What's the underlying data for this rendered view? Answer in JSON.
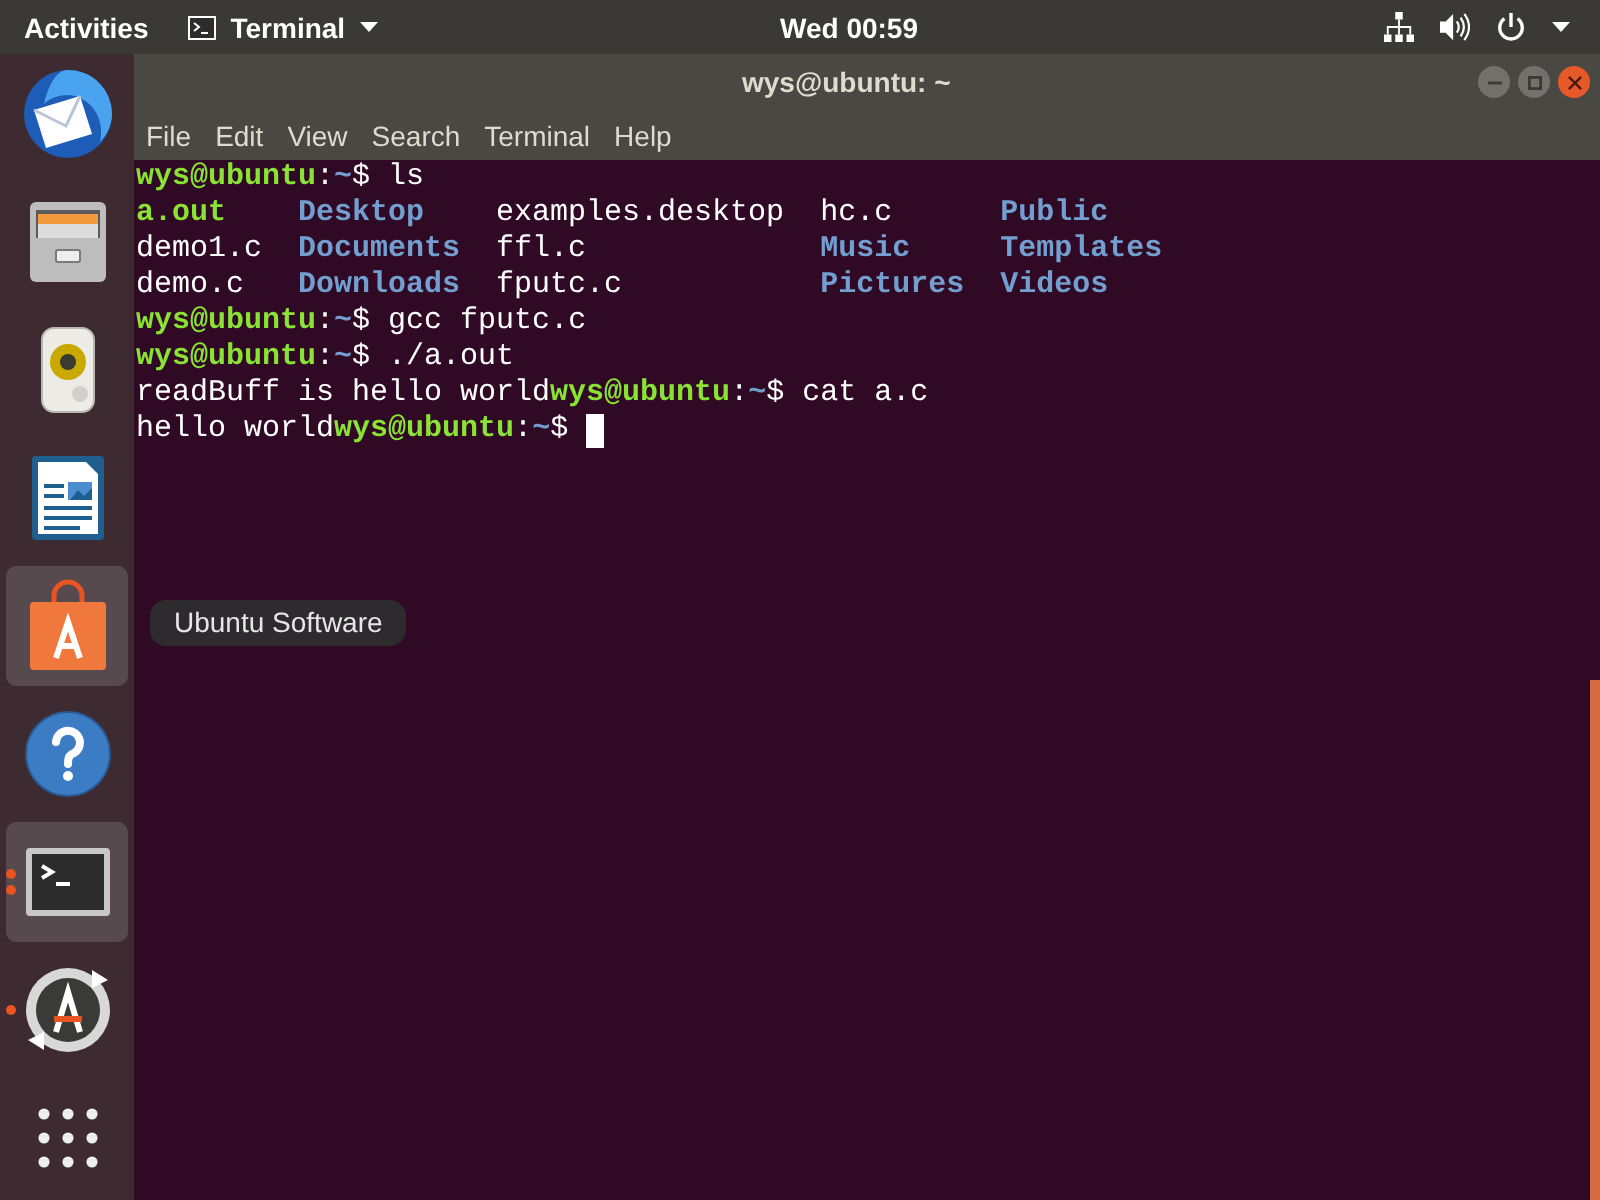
{
  "top_bar": {
    "activities": "Activities",
    "app_menu": "Terminal",
    "clock": "Wed 00:59"
  },
  "dock": {
    "items": [
      {
        "kind": "mail",
        "highlighted": false,
        "running": false,
        "multiple_windows": false
      },
      {
        "kind": "files",
        "highlighted": false,
        "running": false,
        "multiple_windows": false
      },
      {
        "kind": "music",
        "highlighted": false,
        "running": false,
        "multiple_windows": false
      },
      {
        "kind": "writer",
        "highlighted": false,
        "running": false,
        "multiple_windows": false
      },
      {
        "kind": "software",
        "highlighted": true,
        "running": false,
        "multiple_windows": false
      },
      {
        "kind": "help",
        "highlighted": false,
        "running": false,
        "multiple_windows": false
      },
      {
        "kind": "terminal",
        "highlighted": true,
        "running": true,
        "multiple_windows": true
      },
      {
        "kind": "updater",
        "highlighted": false,
        "running": true,
        "multiple_windows": false
      },
      {
        "kind": "apps",
        "highlighted": false,
        "running": false,
        "multiple_windows": false
      }
    ],
    "tooltip": "Ubuntu Software"
  },
  "window": {
    "title": "wys@ubuntu: ~",
    "menu": [
      "File",
      "Edit",
      "View",
      "Search",
      "Terminal",
      "Help"
    ],
    "terminal": {
      "cursor": true,
      "lines": [
        {
          "kind": "text",
          "segments": [
            {
              "kind": "user",
              "text": "wys@ubuntu"
            },
            {
              "kind": "plain",
              "text": ":"
            },
            {
              "kind": "path",
              "text": "~"
            },
            {
              "kind": "plain",
              "text": "$ ls"
            }
          ]
        },
        {
          "kind": "listing",
          "rows": [
            [
              {
                "kind": "exec",
                "text": "a.out"
              },
              {
                "kind": "dir",
                "text": "Desktop"
              },
              {
                "kind": "plain",
                "text": "examples.desktop"
              },
              {
                "kind": "plain",
                "text": "hc.c"
              },
              {
                "kind": "dir",
                "text": "Public"
              }
            ],
            [
              {
                "kind": "plain",
                "text": "demo1.c"
              },
              {
                "kind": "dir",
                "text": "Documents"
              },
              {
                "kind": "plain",
                "text": "ffl.c"
              },
              {
                "kind": "dir",
                "text": "Music"
              },
              {
                "kind": "dir",
                "text": "Templates"
              }
            ],
            [
              {
                "kind": "plain",
                "text": "demo.c"
              },
              {
                "kind": "dir",
                "text": "Downloads"
              },
              {
                "kind": "plain",
                "text": "fputc.c"
              },
              {
                "kind": "dir",
                "text": "Pictures"
              },
              {
                "kind": "dir",
                "text": "Videos"
              }
            ]
          ]
        },
        {
          "kind": "text",
          "segments": [
            {
              "kind": "user",
              "text": "wys@ubuntu"
            },
            {
              "kind": "plain",
              "text": ":"
            },
            {
              "kind": "path",
              "text": "~"
            },
            {
              "kind": "plain",
              "text": "$ gcc fputc.c"
            }
          ]
        },
        {
          "kind": "text",
          "segments": [
            {
              "kind": "user",
              "text": "wys@ubuntu"
            },
            {
              "kind": "plain",
              "text": ":"
            },
            {
              "kind": "path",
              "text": "~"
            },
            {
              "kind": "plain",
              "text": "$ ./a.out"
            }
          ]
        },
        {
          "kind": "text",
          "segments": [
            {
              "kind": "plain",
              "text": "readBuff is hello world"
            },
            {
              "kind": "user",
              "text": "wys@ubuntu"
            },
            {
              "kind": "plain",
              "text": ":"
            },
            {
              "kind": "path",
              "text": "~"
            },
            {
              "kind": "plain",
              "text": "$ cat a.c"
            }
          ]
        },
        {
          "kind": "text",
          "segments": [
            {
              "kind": "plain",
              "text": "hello world"
            },
            {
              "kind": "user",
              "text": "wys@ubuntu"
            },
            {
              "kind": "plain",
              "text": ":"
            },
            {
              "kind": "path",
              "text": "~"
            },
            {
              "kind": "plain",
              "text": "$"
            }
          ]
        }
      ]
    }
  }
}
